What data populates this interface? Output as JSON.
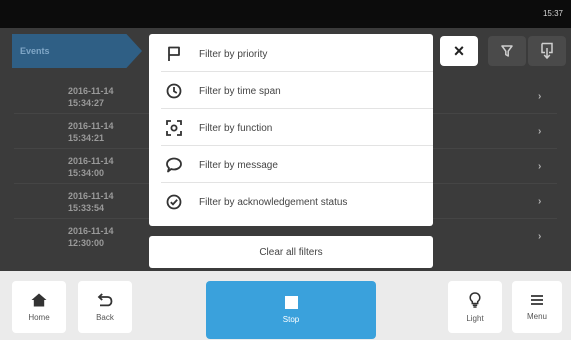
{
  "status_bar": {
    "time": "15:37"
  },
  "header": {
    "tab_label": "Events"
  },
  "toolbar": {
    "close_symbol": "×",
    "close_icon": "close-icon",
    "filter_icon": "filter-icon",
    "export_icon": "export-icon"
  },
  "events": [
    {
      "date": "2016-11-14",
      "time": "15:34:27"
    },
    {
      "date": "2016-11-14",
      "time": "15:34:21"
    },
    {
      "date": "2016-11-14",
      "time": "15:34:00"
    },
    {
      "date": "2016-11-14",
      "time": "15:33:54"
    },
    {
      "date": "2016-11-14",
      "time": "12:30:00"
    }
  ],
  "filter_menu": {
    "items": [
      {
        "label": "Filter by priority",
        "icon": "flag-icon"
      },
      {
        "label": "Filter by time span",
        "icon": "clock-icon"
      },
      {
        "label": "Filter by function",
        "icon": "function-icon"
      },
      {
        "label": "Filter by message",
        "icon": "message-icon"
      },
      {
        "label": "Filter by acknowledgement status",
        "icon": "check-circle-icon"
      }
    ],
    "clear_label": "Clear all filters"
  },
  "bottom_bar": {
    "home_label": "Home",
    "back_label": "Back",
    "stop_label": "Stop",
    "light_label": "Light",
    "menu_label": "Menu"
  },
  "colors": {
    "accent": "#3aa1dc",
    "events_tab": "#2f5f85",
    "background": "#3b3b3b",
    "status_bar": "#0c0c0c"
  }
}
